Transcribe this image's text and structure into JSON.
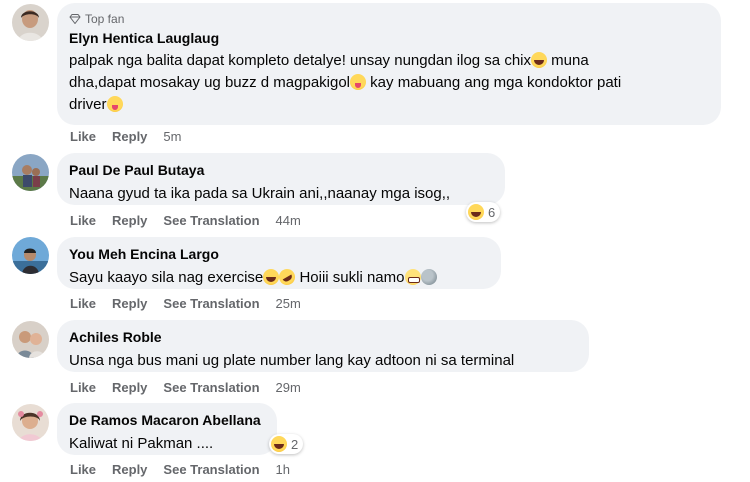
{
  "comments": [
    {
      "badge": "Top fan",
      "author": "Elyn Hentica Lauglaug",
      "line1": "palpak nga balita dapat kompleto detalye! unsay nungdan ilog sa chix",
      "line1b": " muna",
      "line2": "dha,dapat mosakay ug buzz d magpakigol",
      "line2b": " kay mabuang ang mga kondoktor pati",
      "line3": "driver",
      "like": "Like",
      "reply": "Reply",
      "time": "5m"
    },
    {
      "author": "Paul De Paul Butaya",
      "text": "Naana gyud ta ika pada sa Ukrain ani,,naanay mga isog,,",
      "like": "Like",
      "reply": "Reply",
      "see_translation": "See Translation",
      "time": "44m",
      "reaction_count": "6"
    },
    {
      "author": "You Meh Encina Largo",
      "text_a": "Sayu kaayo sila nag exercise",
      "text_b": "  Hoiii sukli namo",
      "like": "Like",
      "reply": "Reply",
      "see_translation": "See Translation",
      "time": "25m"
    },
    {
      "author": "Achiles Roble",
      "text": "Unsa nga bus mani ug plate number lang kay adtoon ni sa terminal",
      "like": "Like",
      "reply": "Reply",
      "see_translation": "See Translation",
      "time": "29m"
    },
    {
      "author": "De Ramos Macaron Abellana",
      "text": "Kaliwat ni Pakman ....",
      "like": "Like",
      "reply": "Reply",
      "see_translation": "See Translation",
      "time": "1h",
      "reaction_count": "2"
    }
  ]
}
